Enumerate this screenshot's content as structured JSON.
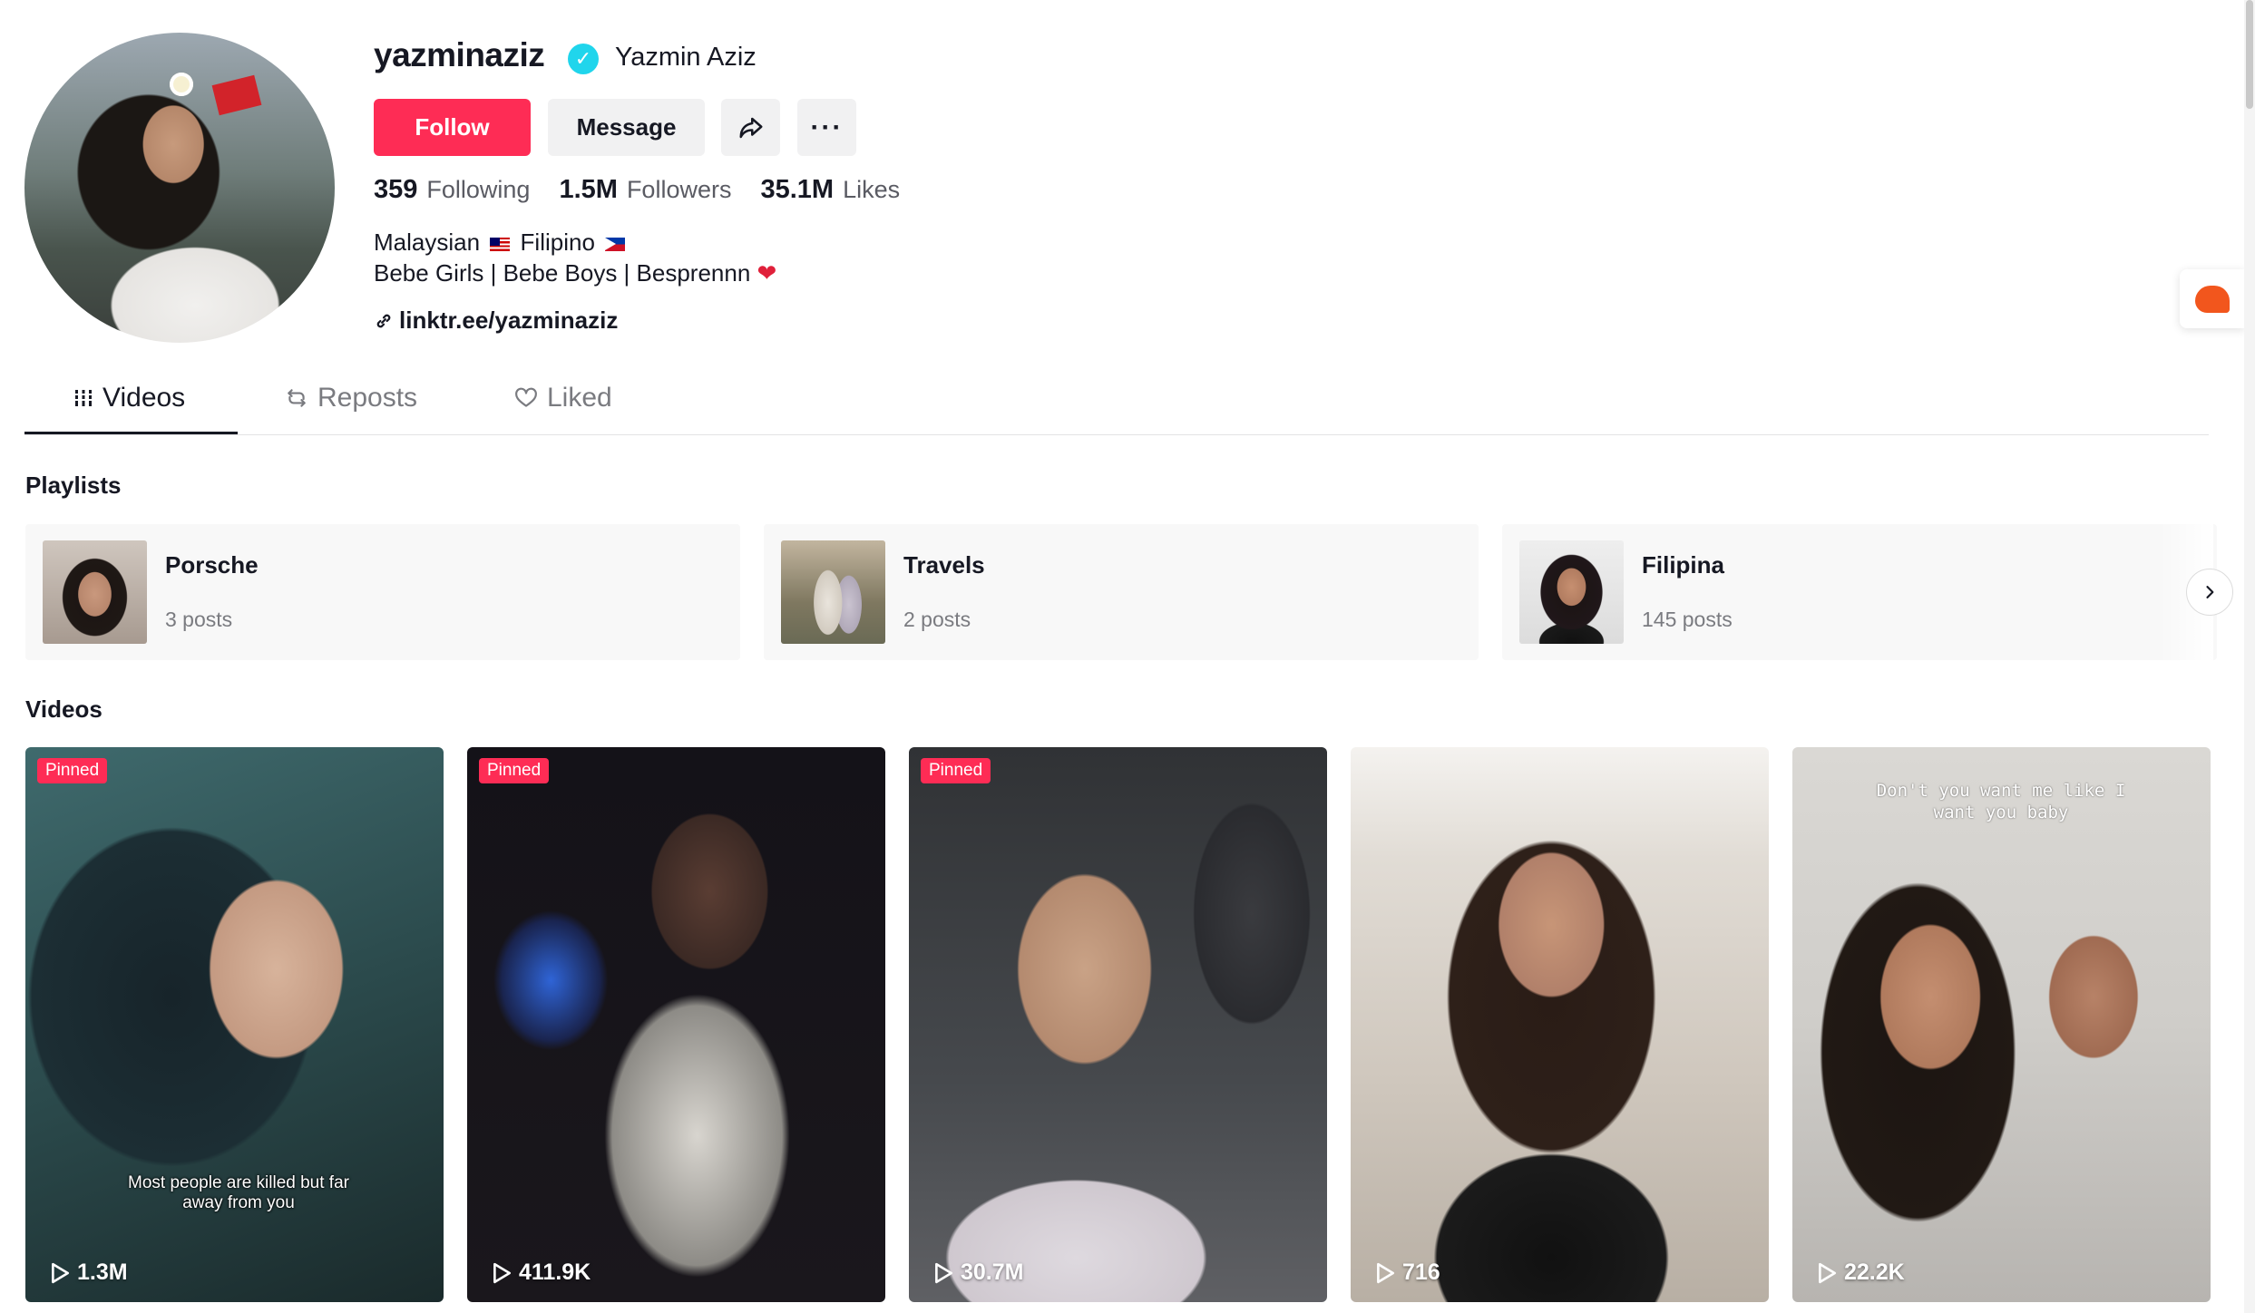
{
  "profile": {
    "username": "yazminaziz",
    "display_name": "Yazmin Aziz",
    "verified_icon": "verified-badge-icon",
    "follow_label": "Follow",
    "message_label": "Message",
    "stats": {
      "following_count": "359",
      "following_label": "Following",
      "followers_count": "1.5M",
      "followers_label": "Followers",
      "likes_count": "35.1M",
      "likes_label": "Likes"
    },
    "bio_line1_a": "Malaysian",
    "bio_line1_b": "Filipino",
    "bio_line2": "Bebe Girls | Bebe Boys | Besprennn",
    "link": "linktr.ee/yazminaziz"
  },
  "tabs": [
    {
      "label": "Videos",
      "icon": "grid-icon",
      "active": true
    },
    {
      "label": "Reposts",
      "icon": "repost-icon",
      "active": false
    },
    {
      "label": "Liked",
      "icon": "heart-outline-icon",
      "active": false
    }
  ],
  "playlists_title": "Playlists",
  "playlists": [
    {
      "name": "Porsche",
      "count": "3 posts"
    },
    {
      "name": "Travels",
      "count": "2 posts"
    },
    {
      "name": "Filipina",
      "count": "145 posts"
    }
  ],
  "videos_title": "Videos",
  "pinned_label": "Pinned",
  "videos": [
    {
      "pinned": true,
      "views": "1.3M",
      "caption": "Most people are killed but far away from you"
    },
    {
      "pinned": true,
      "views": "411.9K",
      "caption": ""
    },
    {
      "pinned": true,
      "views": "30.7M",
      "caption": ""
    },
    {
      "pinned": false,
      "views": "716",
      "caption": ""
    },
    {
      "pinned": false,
      "views": "22.2K",
      "caption": "Don't you want me like I want you baby"
    }
  ],
  "colors": {
    "accent": "#fe2c55",
    "verified": "#20d5ec",
    "text": "#161823",
    "muted": "#7a7b80"
  }
}
